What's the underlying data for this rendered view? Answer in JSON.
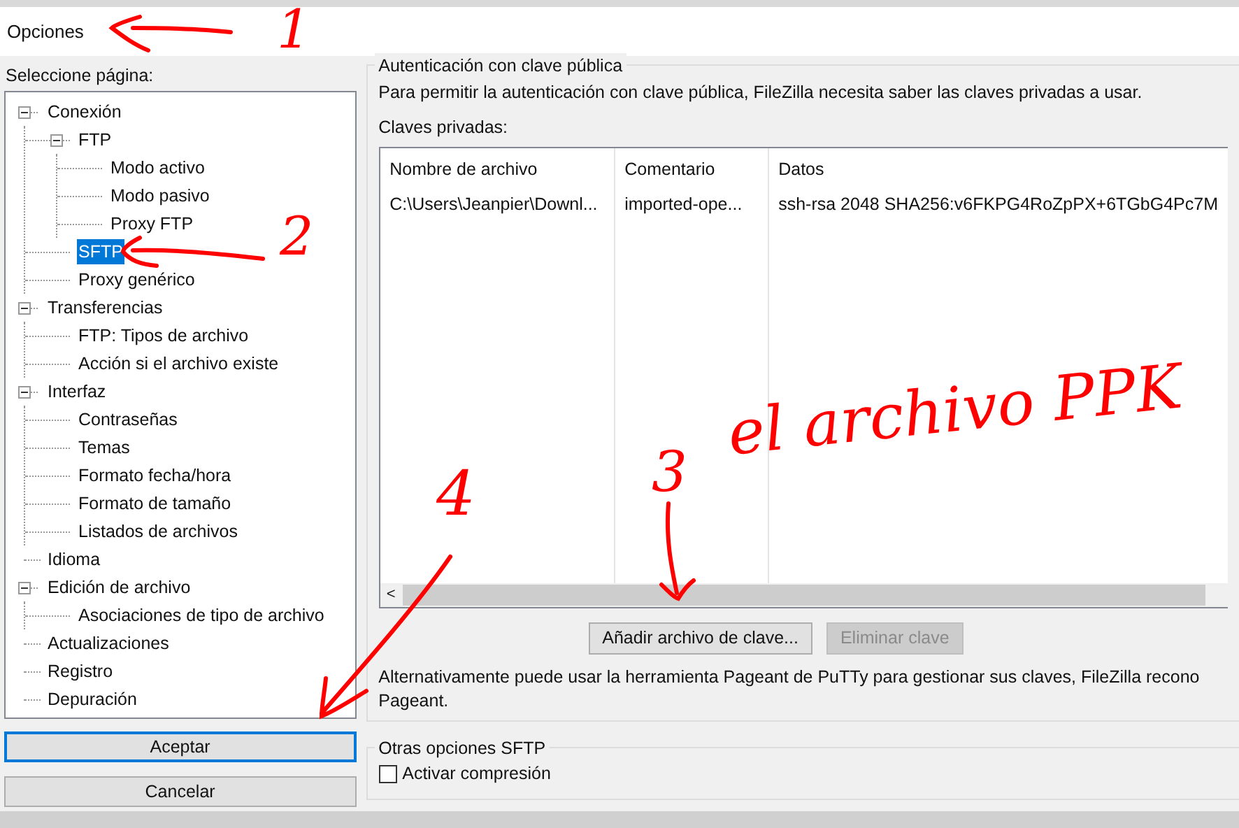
{
  "window": {
    "title": "Opciones"
  },
  "sidebar": {
    "label": "Seleccione página:",
    "tree": [
      {
        "label": "Conexión",
        "selected": false,
        "expanded": true,
        "children": [
          {
            "label": "FTP",
            "selected": false,
            "expanded": true,
            "children": [
              {
                "label": "Modo activo",
                "selected": false
              },
              {
                "label": "Modo pasivo",
                "selected": false
              },
              {
                "label": "Proxy FTP",
                "selected": false
              }
            ]
          },
          {
            "label": "SFTP",
            "selected": true
          },
          {
            "label": "Proxy genérico",
            "selected": false
          }
        ]
      },
      {
        "label": "Transferencias",
        "selected": false,
        "expanded": true,
        "children": [
          {
            "label": "FTP: Tipos de archivo",
            "selected": false
          },
          {
            "label": "Acción si el archivo existe",
            "selected": false
          }
        ]
      },
      {
        "label": "Interfaz",
        "selected": false,
        "expanded": true,
        "children": [
          {
            "label": "Contraseñas",
            "selected": false
          },
          {
            "label": "Temas",
            "selected": false
          },
          {
            "label": "Formato fecha/hora",
            "selected": false
          },
          {
            "label": "Formato de tamaño",
            "selected": false
          },
          {
            "label": "Listados de archivos",
            "selected": false
          }
        ]
      },
      {
        "label": "Idioma",
        "selected": false
      },
      {
        "label": "Edición de archivo",
        "selected": false,
        "expanded": true,
        "children": [
          {
            "label": "Asociaciones de tipo de archivo",
            "selected": false
          }
        ]
      },
      {
        "label": "Actualizaciones",
        "selected": false
      },
      {
        "label": "Registro",
        "selected": false
      },
      {
        "label": "Depuración",
        "selected": false
      }
    ],
    "buttons": [
      {
        "label": "Aceptar",
        "focused": true
      },
      {
        "label": "Cancelar",
        "focused": false
      }
    ]
  },
  "public_key_group": {
    "title": "Autenticación con clave pública",
    "description": "Para permitir la autenticación con clave pública, FileZilla necesita saber las claves privadas a usar.",
    "list_label": "Claves privadas:",
    "table": {
      "columns": [
        "Nombre de archivo",
        "Comentario",
        "Datos"
      ],
      "rows": [
        [
          "C:\\Users\\Jeanpier\\Downl...",
          "imported-ope...",
          "ssh-rsa 2048 SHA256:v6FKPG4RoZpPX+6TGbG4Pc7M"
        ]
      ],
      "scroll_arrow": "<"
    },
    "buttons": [
      {
        "label": "Añadir archivo de clave...",
        "disabled": false
      },
      {
        "label": "Eliminar clave",
        "disabled": true
      }
    ],
    "note_lines": [
      "Alternativamente puede usar la herramienta Pageant de PuTTy para gestionar sus claves, FileZilla recono",
      "Pageant."
    ]
  },
  "other_group": {
    "title": "Otras opciones SFTP",
    "checkbox": {
      "label": "Activar compresión",
      "checked": false
    }
  },
  "annotations": [
    {
      "text": "1"
    },
    {
      "text": "2"
    },
    {
      "text": "3"
    },
    {
      "text": "4"
    },
    {
      "text": "el archivo PPK"
    }
  ]
}
